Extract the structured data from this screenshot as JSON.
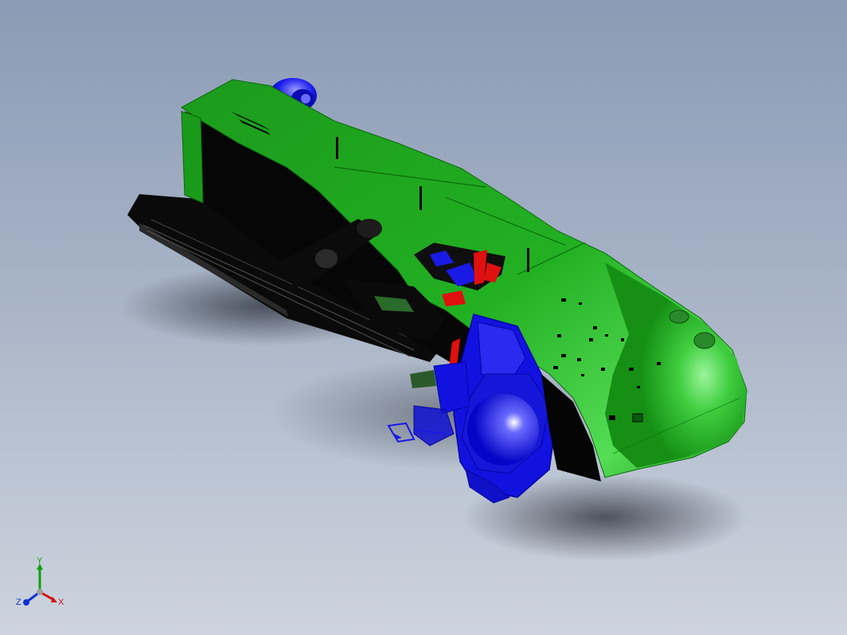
{
  "viewport": {
    "background_top": "#8b9bb5",
    "background_bottom": "#cdd4de"
  },
  "model": {
    "body_color": "#1fa51f",
    "body_highlight": "#5fe05f",
    "hardware_color": "#1010e0",
    "detail_color": "#e01010",
    "interior_color": "#000000"
  },
  "triad": {
    "x_label": "X",
    "y_label": "Y",
    "z_label": "Z",
    "x_color": "#d01010",
    "y_color": "#10a010",
    "z_color": "#1030d0"
  }
}
